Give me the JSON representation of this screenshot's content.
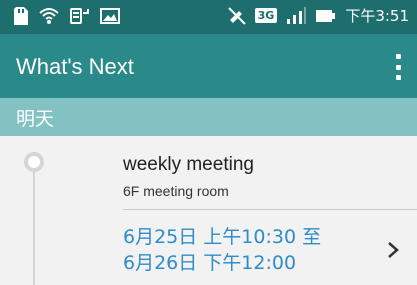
{
  "status_bar": {
    "time": "下午3:51",
    "network": "3G"
  },
  "app_bar": {
    "title": "What's Next"
  },
  "section": {
    "label": "明天"
  },
  "event": {
    "title": "weekly meeting",
    "location": "6F meeting room",
    "time_line1": "6月25日 上午10:30 至",
    "time_line2": "6月26日 下午12:00"
  },
  "colors": {
    "status_bar": "#1e6e6e",
    "app_bar": "#2a8a8a",
    "section": "#83c2c3",
    "time_text": "#2e8cc7"
  }
}
